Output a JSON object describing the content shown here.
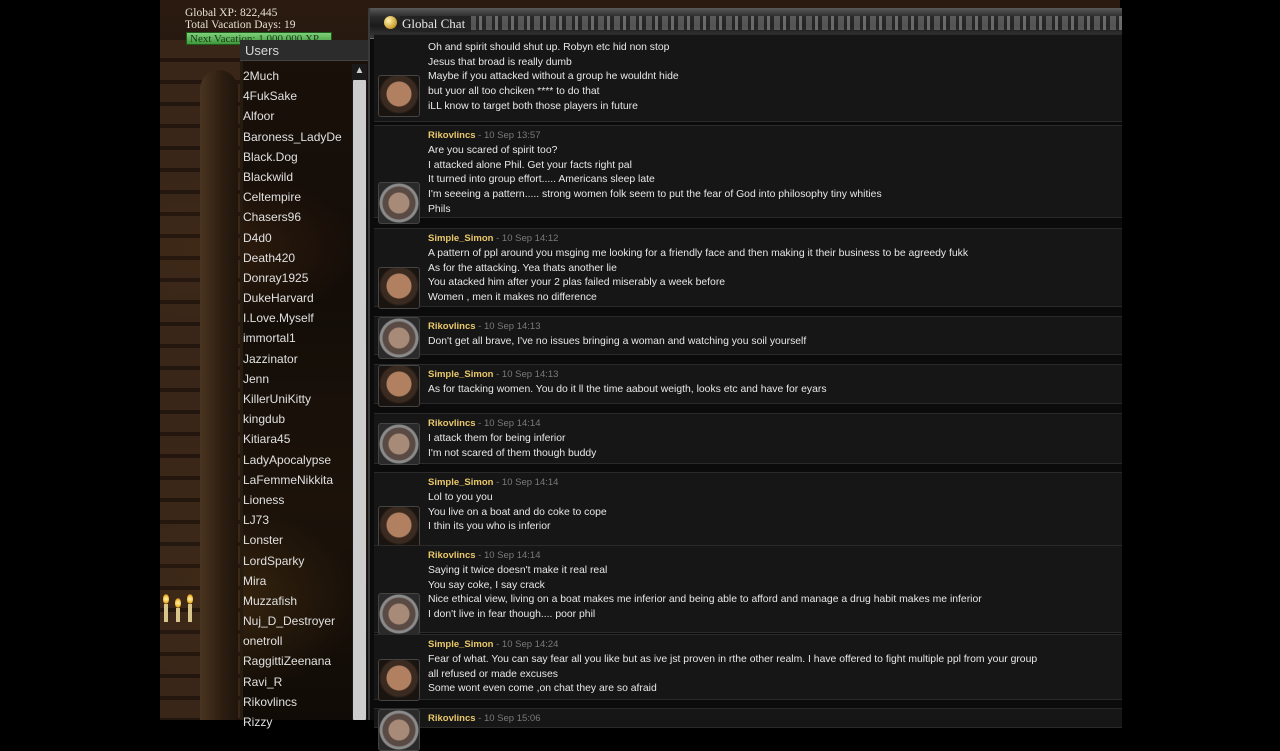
{
  "stats": {
    "global_xp": "Global XP: 822,445",
    "vacation_days": "Total Vacation Days: 19",
    "next_vacation": "Next Vacation: 1,000,000 XP"
  },
  "users_panel": {
    "header": "Users",
    "scroll_up_icon": "chevron-up-icon",
    "items": [
      "2Much",
      "4FukSake",
      "Alfoor",
      "Baroness_LadyDe",
      "Black.Dog",
      "Blackwild",
      "Celtempire",
      "Chasers96",
      "D4d0",
      "Death420",
      "Donray1925",
      "DukeHarvard",
      "I.Love.Myself",
      "immortal1",
      "Jazzinator",
      "Jenn",
      "KillerUniKitty",
      "kingdub",
      "Kitiara45",
      "LadyApocalypse",
      "LaFemmeNikkita",
      "Lioness",
      "LJ73",
      "Lonster",
      "LordSparky",
      "Mira",
      "Muzzafish",
      "Nuj_D_Destroyer",
      "onetroll",
      "RaggittiZeenana",
      "Ravi_R",
      "Rikovlincs",
      "Rizzy"
    ]
  },
  "chat": {
    "title": "Global Chat",
    "title_icon": "globe-icon",
    "messages": [
      {
        "author": "",
        "time": "",
        "avatar": "dark",
        "lines": [
          "Oh and spirit should shut up.  Robyn etc hid non stop",
          "Jesus that broad is really dumb",
          "Maybe if you attacked without a group he wouldnt hide",
          "but yuor all too chciken **** to do that",
          "iLL know to target both those players in future"
        ]
      },
      {
        "author": "Rikovlincs",
        "time": " - 10 Sep 13:57",
        "avatar": "hood",
        "lines": [
          "Are you scared of spirit too?",
          "I attacked alone Phil. Get your facts right pal",
          "It turned into group effort..... Americans sleep late",
          "I'm seeeing a pattern..... strong women folk seem to put the fear of God into philosophy tiny whities",
          "Phils"
        ]
      },
      {
        "author": "Simple_Simon",
        "time": " - 10 Sep 14:12",
        "avatar": "dark",
        "lines": [
          "A pattern of ppl around you msging me looking for a friendly face and then making it their business to be agreedy fukk",
          "As for the attacking.  Yea thats another lie",
          "You atacked him after your 2 plas failed miserably a week before",
          "Women , men it makes no difference"
        ]
      },
      {
        "author": "Rikovlincs",
        "time": " - 10 Sep 14:13",
        "avatar": "hood",
        "lines": [
          "Don't get all brave, I've no issues bringing a woman and watching you soil yourself"
        ]
      },
      {
        "author": "Simple_Simon",
        "time": " - 10 Sep 14:13",
        "avatar": "dark",
        "lines": [
          "As for ttacking women.  You do it ll the time aabout weigth, looks etc and have for eyars"
        ]
      },
      {
        "author": "Rikovlincs",
        "time": " - 10 Sep 14:14",
        "avatar": "hood",
        "lines": [
          "I attack them for being inferior",
          "I'm not scared of them though buddy"
        ]
      },
      {
        "author": "Simple_Simon",
        "time": " - 10 Sep 14:14",
        "avatar": "dark",
        "lines": [
          "Lol to you you",
          "You live on a boat and do coke to cope",
          "I thin its you who is inferior"
        ]
      },
      {
        "author": "Rikovlincs",
        "time": " - 10 Sep 14:14",
        "avatar": "hood",
        "lines": [
          "Saying it twice doesn't make it real real",
          "You say coke, I say crack",
          "Nice ethical view, living on a boat makes me inferior and being able to afford and manage a drug habit makes me inferior",
          "I don't live in fear though.... poor phil"
        ]
      },
      {
        "author": "Simple_Simon",
        "time": " - 10 Sep 14:24",
        "avatar": "dark",
        "lines": [
          "Fear of what. You can say fear all you like but as ive jst proven in rthe other realm.  I  have offered to fight multiple ppl from your group",
          "all refused or made excuses",
          "Some wont even come ,on chat they are so afraid"
        ]
      },
      {
        "author": "Rikovlincs",
        "time": " - 10 Sep 15:06",
        "avatar": "hood",
        "lines": []
      }
    ]
  }
}
